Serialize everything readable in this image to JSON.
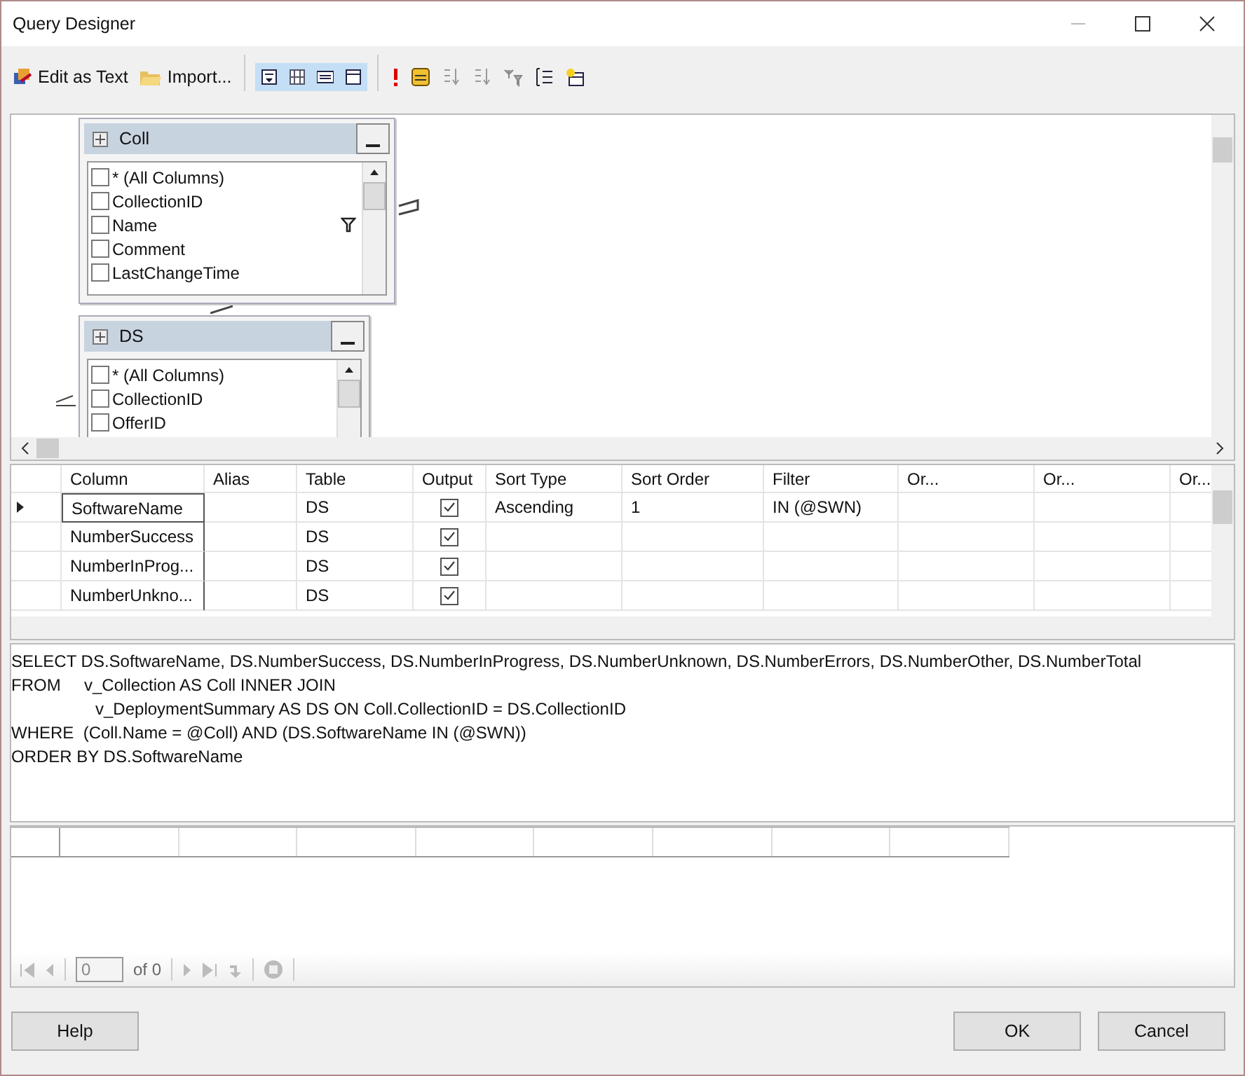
{
  "window": {
    "title": "Query Designer"
  },
  "toolbar": {
    "text_buttons": [
      {
        "kind": "edit",
        "label": "Edit as Text"
      },
      {
        "kind": "import",
        "label": "Import..."
      }
    ],
    "pane_toggles": [
      {
        "kind": "diagram",
        "selected": true
      },
      {
        "kind": "grid",
        "selected": true
      },
      {
        "kind": "sql",
        "selected": true
      },
      {
        "kind": "results",
        "selected": true
      }
    ]
  },
  "diagram": {
    "tables": [
      {
        "name": "Coll",
        "columns": [
          {
            "name": "* (All Columns)",
            "checked": false,
            "filtered": false
          },
          {
            "name": "CollectionID",
            "checked": false,
            "filtered": false
          },
          {
            "name": "Name",
            "checked": false,
            "filtered": true
          },
          {
            "name": "Comment",
            "checked": false,
            "filtered": false
          },
          {
            "name": "LastChangeTime",
            "checked": false,
            "filtered": false
          }
        ]
      },
      {
        "name": "DS",
        "columns": [
          {
            "name": "* (All Columns)",
            "checked": false,
            "filtered": false
          },
          {
            "name": "CollectionID",
            "checked": false,
            "filtered": false
          },
          {
            "name": "OfferID",
            "checked": false,
            "filtered": false
          }
        ]
      }
    ]
  },
  "grid": {
    "columns": [
      "Column",
      "Alias",
      "Table",
      "Output",
      "Sort Type",
      "Sort Order",
      "Filter",
      "Or...",
      "Or...",
      "Or..."
    ],
    "rows": [
      {
        "current": true,
        "column": "SoftwareName",
        "table": "DS",
        "output": true,
        "sort_type": "Ascending",
        "sort_order": "1",
        "filter": "IN (@SWN)"
      },
      {
        "current": false,
        "column": "NumberSuccess",
        "table": "DS",
        "output": true
      },
      {
        "current": false,
        "column": "NumberInProg...",
        "table": "DS",
        "output": true
      },
      {
        "current": false,
        "column": "NumberUnkno...",
        "table": "DS",
        "output": true
      }
    ]
  },
  "sql": {
    "lines": [
      "SELECT DS.SoftwareName, DS.NumberSuccess, DS.NumberInProgress, DS.NumberUnknown, DS.NumberErrors, DS.NumberOther, DS.NumberTotal",
      "FROM     v_Collection AS Coll INNER JOIN",
      "                  v_DeploymentSummary AS DS ON Coll.CollectionID = DS.CollectionID",
      "WHERE  (Coll.Name = @Coll) AND (DS.SoftwareName IN (@SWN))",
      "ORDER BY DS.SoftwareName"
    ]
  },
  "results": {
    "page": "0",
    "page_count": "of 0"
  },
  "buttons": {
    "help": "Help",
    "ok": "OK",
    "cancel": "Cancel"
  }
}
